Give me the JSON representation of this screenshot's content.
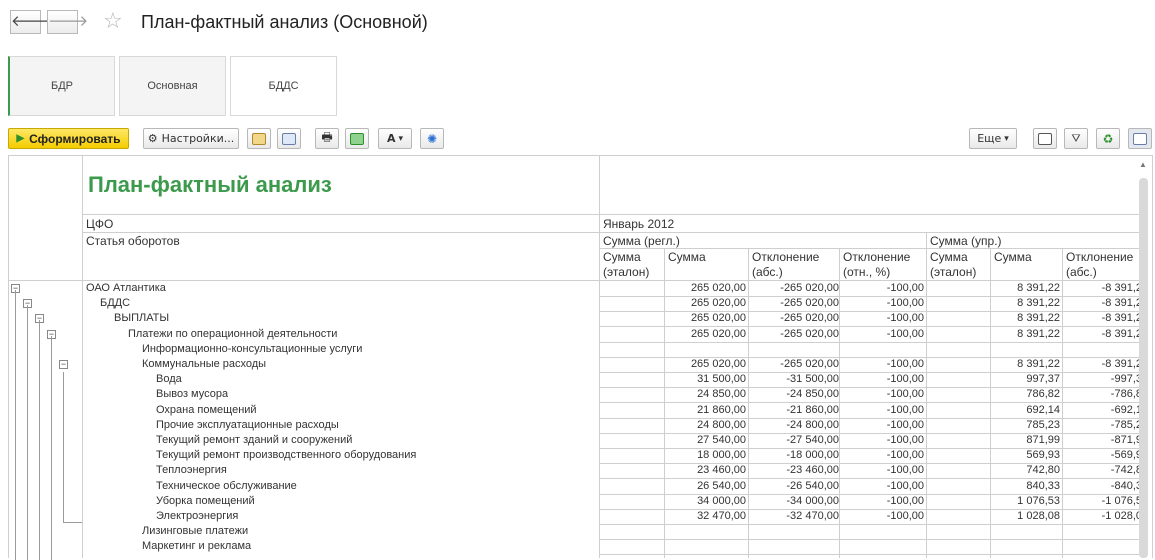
{
  "window": {
    "title": "План-фактный анализ (Основной)",
    "back_glyph": "🡐",
    "forward_glyph": "🡒",
    "star_glyph": "☆"
  },
  "tabs": [
    {
      "label": "БДР",
      "active": false
    },
    {
      "label": "Основная",
      "active": false
    },
    {
      "label": "БДДС",
      "active": true
    }
  ],
  "toolbar": {
    "generate_label": "Сформировать",
    "settings_label": "Настройки...",
    "more_label": "Еще",
    "dropdown_glyph": "▾"
  },
  "report": {
    "title": "План-фактный анализ",
    "header": {
      "cfo_label": "ЦФО",
      "article_label": "Статья оборотов",
      "period": "Январь 2012",
      "group_regl": "Сумма (регл.)",
      "group_upr": "Сумма (упр.)",
      "col_etalon_1": "Сумма",
      "col_etalon_2": "(эталон)",
      "col_sum": "Сумма",
      "col_dev_abs_1": "Отклонение",
      "col_dev_abs_2": "(абс.)",
      "col_dev_rel_1": "Отклонение",
      "col_dev_rel_2": "(отн., %)",
      "col_etalon_upr_1": "Сумма",
      "col_etalon_upr_2": "(эталон)",
      "col_sum_upr": "Сумма",
      "col_dev_abs_upr_1": "Отклонение",
      "col_dev_abs_upr_2": "(абс.)"
    },
    "rows": [
      {
        "name": "ОАО Атлантика",
        "sum": "265 020,00",
        "dev_abs": "-265 020,00",
        "dev_rel": "-100,00",
        "sum_upr": "8 391,22",
        "dev_abs_upr": "-8 391,2"
      },
      {
        "name": "БДДС",
        "sum": "265 020,00",
        "dev_abs": "-265 020,00",
        "dev_rel": "-100,00",
        "sum_upr": "8 391,22",
        "dev_abs_upr": "-8 391,2"
      },
      {
        "name": "ВЫПЛАТЫ",
        "sum": "265 020,00",
        "dev_abs": "-265 020,00",
        "dev_rel": "-100,00",
        "sum_upr": "8 391,22",
        "dev_abs_upr": "-8 391,2"
      },
      {
        "name": "Платежи по операционной деятельности",
        "sum": "265 020,00",
        "dev_abs": "-265 020,00",
        "dev_rel": "-100,00",
        "sum_upr": "8 391,22",
        "dev_abs_upr": "-8 391,2"
      },
      {
        "name": "Информационно-консультационные услуги",
        "sum": "",
        "dev_abs": "",
        "dev_rel": "",
        "sum_upr": "",
        "dev_abs_upr": ""
      },
      {
        "name": "Коммунальные расходы",
        "sum": "265 020,00",
        "dev_abs": "-265 020,00",
        "dev_rel": "-100,00",
        "sum_upr": "8 391,22",
        "dev_abs_upr": "-8 391,2"
      },
      {
        "name": "Вода",
        "sum": "31 500,00",
        "dev_abs": "-31 500,00",
        "dev_rel": "-100,00",
        "sum_upr": "997,37",
        "dev_abs_upr": "-997,3"
      },
      {
        "name": "Вывоз мусора",
        "sum": "24 850,00",
        "dev_abs": "-24 850,00",
        "dev_rel": "-100,00",
        "sum_upr": "786,82",
        "dev_abs_upr": "-786,8"
      },
      {
        "name": "Охрана помещений",
        "sum": "21 860,00",
        "dev_abs": "-21 860,00",
        "dev_rel": "-100,00",
        "sum_upr": "692,14",
        "dev_abs_upr": "-692,1"
      },
      {
        "name": "Прочие эксплуатационные расходы",
        "sum": "24 800,00",
        "dev_abs": "-24 800,00",
        "dev_rel": "-100,00",
        "sum_upr": "785,23",
        "dev_abs_upr": "-785,2"
      },
      {
        "name": "Текущий ремонт зданий и сооружений",
        "sum": "27 540,00",
        "dev_abs": "-27 540,00",
        "dev_rel": "-100,00",
        "sum_upr": "871,99",
        "dev_abs_upr": "-871,9"
      },
      {
        "name": "Текущий ремонт производственного оборудования",
        "sum": "18 000,00",
        "dev_abs": "-18 000,00",
        "dev_rel": "-100,00",
        "sum_upr": "569,93",
        "dev_abs_upr": "-569,9"
      },
      {
        "name": "Теплоэнергия",
        "sum": "23 460,00",
        "dev_abs": "-23 460,00",
        "dev_rel": "-100,00",
        "sum_upr": "742,80",
        "dev_abs_upr": "-742,8"
      },
      {
        "name": "Техническое обслуживание",
        "sum": "26 540,00",
        "dev_abs": "-26 540,00",
        "dev_rel": "-100,00",
        "sum_upr": "840,33",
        "dev_abs_upr": "-840,3"
      },
      {
        "name": "Уборка помещений",
        "sum": "34 000,00",
        "dev_abs": "-34 000,00",
        "dev_rel": "-100,00",
        "sum_upr": "1 076,53",
        "dev_abs_upr": "-1 076,5"
      },
      {
        "name": "Электроэнергия",
        "sum": "32 470,00",
        "dev_abs": "-32 470,00",
        "dev_rel": "-100,00",
        "sum_upr": "1 028,08",
        "dev_abs_upr": "-1 028,0"
      },
      {
        "name": "Лизинговые платежи",
        "sum": "",
        "dev_abs": "",
        "dev_rel": "",
        "sum_upr": "",
        "dev_abs_upr": ""
      },
      {
        "name": "Маркетинг и реклама",
        "sum": "",
        "dev_abs": "",
        "dev_rel": "",
        "sum_upr": "",
        "dev_abs_upr": ""
      }
    ],
    "toggle_glyph": "−"
  },
  "colors": {
    "report_title": "#3d9a4c",
    "primary_button": "#f4cc00"
  }
}
